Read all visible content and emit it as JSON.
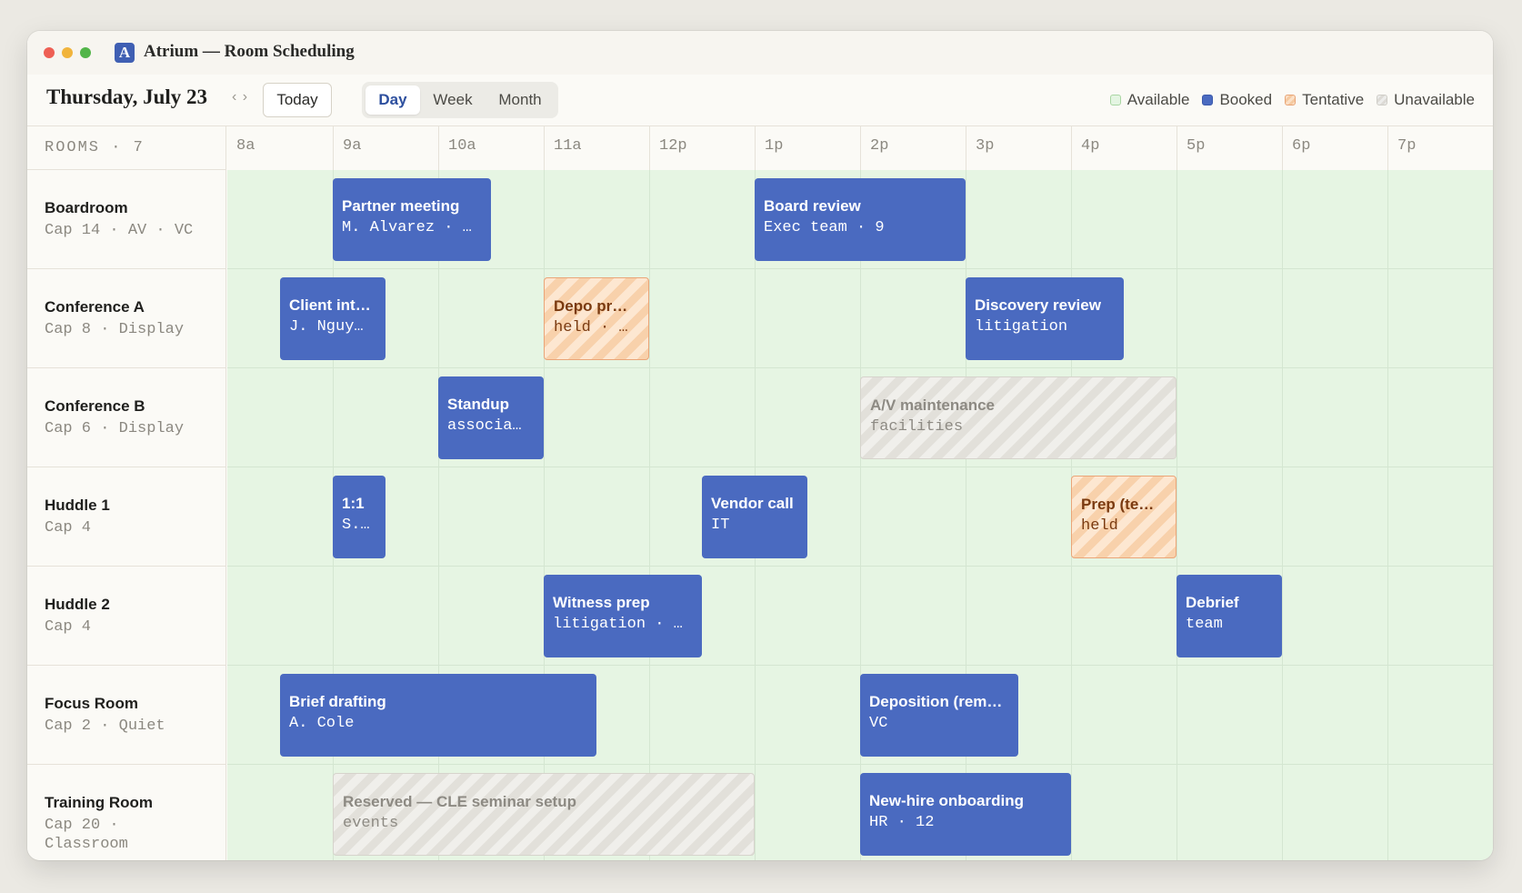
{
  "window": {
    "title": "Atrium — Room Scheduling",
    "logo_letter": "A"
  },
  "toolbar": {
    "date": "Thursday, July 23",
    "nav_arrows": "‹ ›",
    "today_label": "Today",
    "views": [
      "Day",
      "Week",
      "Month"
    ],
    "active_view": "Day"
  },
  "legend": [
    {
      "key": "available",
      "label": "Available",
      "color": "#e4f5e2"
    },
    {
      "key": "booked",
      "label": "Booked",
      "color": "#4a6ac0"
    },
    {
      "key": "tentative",
      "label": "Tentative",
      "color": "#f5c9a0"
    },
    {
      "key": "unavailable",
      "label": "Unavailable",
      "color": "#dcdad5"
    }
  ],
  "grid": {
    "rooms_header": "ROOMS · 7",
    "hours": [
      "8a",
      "9a",
      "10a",
      "11a",
      "12p",
      "1p",
      "2p",
      "3p",
      "4p",
      "5p",
      "6p",
      "7p"
    ],
    "rooms": [
      {
        "name": "Boardroom",
        "meta": "Cap 14 · AV · VC",
        "events": [
          {
            "title": "Partner meeting",
            "sub": "M. Alvarez · …",
            "status": "booked",
            "start": 9.0,
            "end": 10.5
          },
          {
            "title": "Board review",
            "sub": "Exec team · 9",
            "status": "booked",
            "start": 13.0,
            "end": 15.0
          }
        ]
      },
      {
        "name": "Conference A",
        "meta": "Cap 8 · Display",
        "events": [
          {
            "title": "Client int…",
            "sub": "J. Nguy…",
            "status": "booked",
            "start": 8.5,
            "end": 9.5
          },
          {
            "title": "Depo pr…",
            "sub": "held · …",
            "status": "tentative",
            "start": 11.0,
            "end": 12.0
          },
          {
            "title": "Discovery review",
            "sub": "litigation",
            "status": "booked",
            "start": 15.0,
            "end": 16.5
          }
        ]
      },
      {
        "name": "Conference B",
        "meta": "Cap 6 · Display",
        "events": [
          {
            "title": "Standup",
            "sub": "associa…",
            "status": "booked",
            "start": 10.0,
            "end": 11.0
          },
          {
            "title": "A/V maintenance",
            "sub": "facilities",
            "status": "unavailable",
            "start": 14.0,
            "end": 17.0
          }
        ]
      },
      {
        "name": "Huddle 1",
        "meta": "Cap 4",
        "events": [
          {
            "title": "1:1",
            "sub": "S.…",
            "status": "booked",
            "start": 9.0,
            "end": 9.5
          },
          {
            "title": "Vendor call",
            "sub": "IT",
            "status": "booked",
            "start": 12.5,
            "end": 13.5
          },
          {
            "title": "Prep (te…",
            "sub": "held",
            "status": "tentative",
            "start": 16.0,
            "end": 17.0
          }
        ]
      },
      {
        "name": "Huddle 2",
        "meta": "Cap 4",
        "events": [
          {
            "title": "Witness prep",
            "sub": "litigation · …",
            "status": "booked",
            "start": 11.0,
            "end": 12.5
          },
          {
            "title": "Debrief",
            "sub": "team",
            "status": "booked",
            "start": 17.0,
            "end": 18.0
          }
        ]
      },
      {
        "name": "Focus Room",
        "meta": "Cap 2 · Quiet",
        "events": [
          {
            "title": "Brief drafting",
            "sub": "A. Cole",
            "status": "booked",
            "start": 8.5,
            "end": 11.5
          },
          {
            "title": "Deposition (rem…",
            "sub": "VC",
            "status": "booked",
            "start": 14.0,
            "end": 15.5
          }
        ]
      },
      {
        "name": "Training Room",
        "meta": "Cap 20 · Classroom",
        "events": [
          {
            "title": "Reserved — CLE seminar setup",
            "sub": "events",
            "status": "unavailable",
            "start": 9.0,
            "end": 13.0
          },
          {
            "title": "New-hire onboarding",
            "sub": "HR · 12",
            "status": "booked",
            "start": 14.0,
            "end": 16.0
          }
        ]
      }
    ]
  }
}
